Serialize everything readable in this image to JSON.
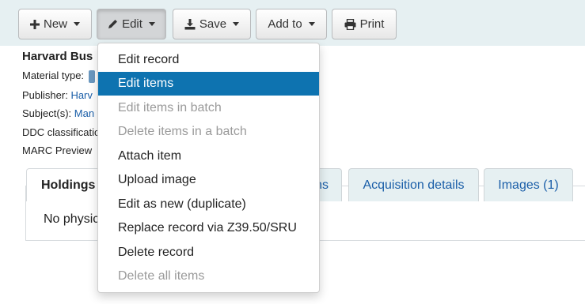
{
  "toolbar": {
    "new_label": "New",
    "edit_label": "Edit",
    "save_label": "Save",
    "add_to_label": "Add to",
    "print_label": "Print"
  },
  "record": {
    "title": "Harvard Bus",
    "material_type_label": "Material type:",
    "publisher_label": "Publisher:",
    "publisher_value": "Harv",
    "subjects_label": "Subject(s):",
    "subjects_value": "Man",
    "ddc_label": "DDC classificatio",
    "marc_label": "MARC Preview"
  },
  "tabs": {
    "holdings": "Holdings",
    "hidden_tab_fragment": "ns",
    "acquisition": "Acquisition details",
    "images": "Images (1)"
  },
  "holdings_panel": {
    "message": "No physic"
  },
  "edit_menu": {
    "items": [
      {
        "label": "Edit record",
        "state": "normal"
      },
      {
        "label": "Edit items",
        "state": "highlighted"
      },
      {
        "label": "Edit items in batch",
        "state": "disabled"
      },
      {
        "label": "Delete items in a batch",
        "state": "disabled"
      },
      {
        "label": "Attach item",
        "state": "normal"
      },
      {
        "label": "Upload image",
        "state": "normal"
      },
      {
        "label": "Edit as new (duplicate)",
        "state": "normal"
      },
      {
        "label": "Replace record via Z39.50/SRU",
        "state": "normal"
      },
      {
        "label": "Delete record",
        "state": "normal"
      },
      {
        "label": "Delete all items",
        "state": "disabled"
      }
    ]
  },
  "colors": {
    "highlight": "#0e73b0",
    "link": "#1a5ea8",
    "toolbar_bg": "#e6f0f2"
  }
}
